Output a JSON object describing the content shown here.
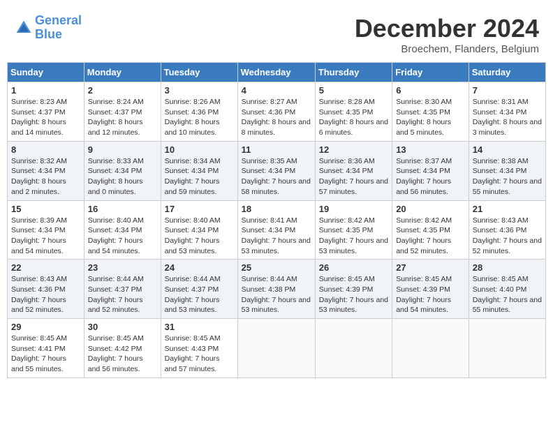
{
  "header": {
    "logo_line1": "General",
    "logo_line2": "Blue",
    "main_title": "December 2024",
    "subtitle": "Broechem, Flanders, Belgium"
  },
  "weekdays": [
    "Sunday",
    "Monday",
    "Tuesday",
    "Wednesday",
    "Thursday",
    "Friday",
    "Saturday"
  ],
  "weeks": [
    [
      {
        "day": "1",
        "sunrise": "8:23 AM",
        "sunset": "4:37 PM",
        "daylight": "8 hours and 14 minutes."
      },
      {
        "day": "2",
        "sunrise": "8:24 AM",
        "sunset": "4:37 PM",
        "daylight": "8 hours and 12 minutes."
      },
      {
        "day": "3",
        "sunrise": "8:26 AM",
        "sunset": "4:36 PM",
        "daylight": "8 hours and 10 minutes."
      },
      {
        "day": "4",
        "sunrise": "8:27 AM",
        "sunset": "4:36 PM",
        "daylight": "8 hours and 8 minutes."
      },
      {
        "day": "5",
        "sunrise": "8:28 AM",
        "sunset": "4:35 PM",
        "daylight": "8 hours and 6 minutes."
      },
      {
        "day": "6",
        "sunrise": "8:30 AM",
        "sunset": "4:35 PM",
        "daylight": "8 hours and 5 minutes."
      },
      {
        "day": "7",
        "sunrise": "8:31 AM",
        "sunset": "4:34 PM",
        "daylight": "8 hours and 3 minutes."
      }
    ],
    [
      {
        "day": "8",
        "sunrise": "8:32 AM",
        "sunset": "4:34 PM",
        "daylight": "8 hours and 2 minutes."
      },
      {
        "day": "9",
        "sunrise": "8:33 AM",
        "sunset": "4:34 PM",
        "daylight": "8 hours and 0 minutes."
      },
      {
        "day": "10",
        "sunrise": "8:34 AM",
        "sunset": "4:34 PM",
        "daylight": "7 hours and 59 minutes."
      },
      {
        "day": "11",
        "sunrise": "8:35 AM",
        "sunset": "4:34 PM",
        "daylight": "7 hours and 58 minutes."
      },
      {
        "day": "12",
        "sunrise": "8:36 AM",
        "sunset": "4:34 PM",
        "daylight": "7 hours and 57 minutes."
      },
      {
        "day": "13",
        "sunrise": "8:37 AM",
        "sunset": "4:34 PM",
        "daylight": "7 hours and 56 minutes."
      },
      {
        "day": "14",
        "sunrise": "8:38 AM",
        "sunset": "4:34 PM",
        "daylight": "7 hours and 55 minutes."
      }
    ],
    [
      {
        "day": "15",
        "sunrise": "8:39 AM",
        "sunset": "4:34 PM",
        "daylight": "7 hours and 54 minutes."
      },
      {
        "day": "16",
        "sunrise": "8:40 AM",
        "sunset": "4:34 PM",
        "daylight": "7 hours and 54 minutes."
      },
      {
        "day": "17",
        "sunrise": "8:40 AM",
        "sunset": "4:34 PM",
        "daylight": "7 hours and 53 minutes."
      },
      {
        "day": "18",
        "sunrise": "8:41 AM",
        "sunset": "4:34 PM",
        "daylight": "7 hours and 53 minutes."
      },
      {
        "day": "19",
        "sunrise": "8:42 AM",
        "sunset": "4:35 PM",
        "daylight": "7 hours and 53 minutes."
      },
      {
        "day": "20",
        "sunrise": "8:42 AM",
        "sunset": "4:35 PM",
        "daylight": "7 hours and 52 minutes."
      },
      {
        "day": "21",
        "sunrise": "8:43 AM",
        "sunset": "4:36 PM",
        "daylight": "7 hours and 52 minutes."
      }
    ],
    [
      {
        "day": "22",
        "sunrise": "8:43 AM",
        "sunset": "4:36 PM",
        "daylight": "7 hours and 52 minutes."
      },
      {
        "day": "23",
        "sunrise": "8:44 AM",
        "sunset": "4:37 PM",
        "daylight": "7 hours and 52 minutes."
      },
      {
        "day": "24",
        "sunrise": "8:44 AM",
        "sunset": "4:37 PM",
        "daylight": "7 hours and 53 minutes."
      },
      {
        "day": "25",
        "sunrise": "8:44 AM",
        "sunset": "4:38 PM",
        "daylight": "7 hours and 53 minutes."
      },
      {
        "day": "26",
        "sunrise": "8:45 AM",
        "sunset": "4:39 PM",
        "daylight": "7 hours and 53 minutes."
      },
      {
        "day": "27",
        "sunrise": "8:45 AM",
        "sunset": "4:39 PM",
        "daylight": "7 hours and 54 minutes."
      },
      {
        "day": "28",
        "sunrise": "8:45 AM",
        "sunset": "4:40 PM",
        "daylight": "7 hours and 55 minutes."
      }
    ],
    [
      {
        "day": "29",
        "sunrise": "8:45 AM",
        "sunset": "4:41 PM",
        "daylight": "7 hours and 55 minutes."
      },
      {
        "day": "30",
        "sunrise": "8:45 AM",
        "sunset": "4:42 PM",
        "daylight": "7 hours and 56 minutes."
      },
      {
        "day": "31",
        "sunrise": "8:45 AM",
        "sunset": "4:43 PM",
        "daylight": "7 hours and 57 minutes."
      },
      null,
      null,
      null,
      null
    ]
  ],
  "labels": {
    "sunrise": "Sunrise: ",
    "sunset": "Sunset: ",
    "daylight": "Daylight: "
  }
}
